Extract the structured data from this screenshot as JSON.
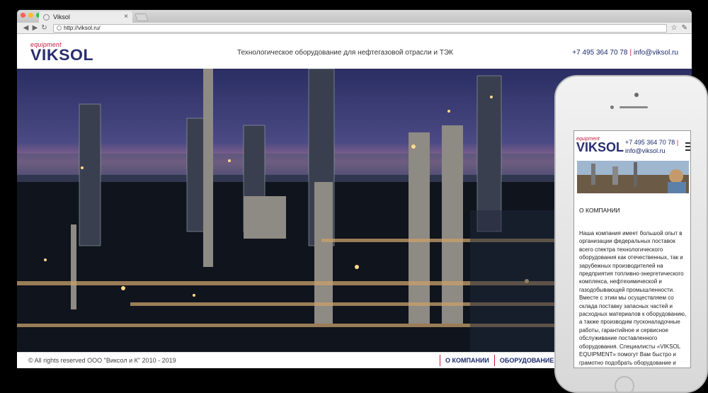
{
  "browser": {
    "tab_title": "Viksol",
    "tab_close": "×",
    "url": "http://viksol.ru/"
  },
  "site": {
    "logo_sub": "equipment",
    "logo_main": "VIKSOL",
    "tagline": "Технологическое оборудование для нефтегазовой отрасли и ТЭК",
    "phone": "+7 495 364 70 78",
    "separator": "|",
    "email": "info@viksol.ru"
  },
  "footer": {
    "copyright": "© All rights reserved ООО \"Виксол и К\" 2010 - 2019",
    "nav": [
      "О КОМПАНИИ",
      "ОБОРУДОВАНИЕ"
    ]
  },
  "mobile": {
    "logo_sub": "equipment",
    "logo_main": "VIKSOL",
    "phone": "+7 495 364 70 78",
    "separator": "|",
    "email": "info@viksol.ru",
    "section_title": "О КОМПАНИИ",
    "body_text": "Наша компания имеет большой опыт в организации федеральных поставок всего спектра технологического оборудования как отечественных, так и зарубежных производителей на предприятия топливно-энергетического комплекса, нефтехимической и газодобывающей промышленности. Вместе с этим мы осуществляем со склада поставку запасных частей и расходных материалов к оборудованию, а также производим пусконаладочные работы, гарантийное и сервисное обслуживание поставленного оборудования. Специалисты «VIKSOL EQUIPMENT» помогут Вам быстро и грамотно подобрать оборудование и комплектующие исходя из Вашей задачи, а"
  },
  "colors": {
    "brand_navy": "#2a2f6e",
    "brand_red": "#c5163a"
  },
  "icons": [
    "globe-icon",
    "back-icon",
    "forward-icon",
    "reload-icon",
    "star-icon",
    "wrench-icon",
    "menu-icon"
  ]
}
